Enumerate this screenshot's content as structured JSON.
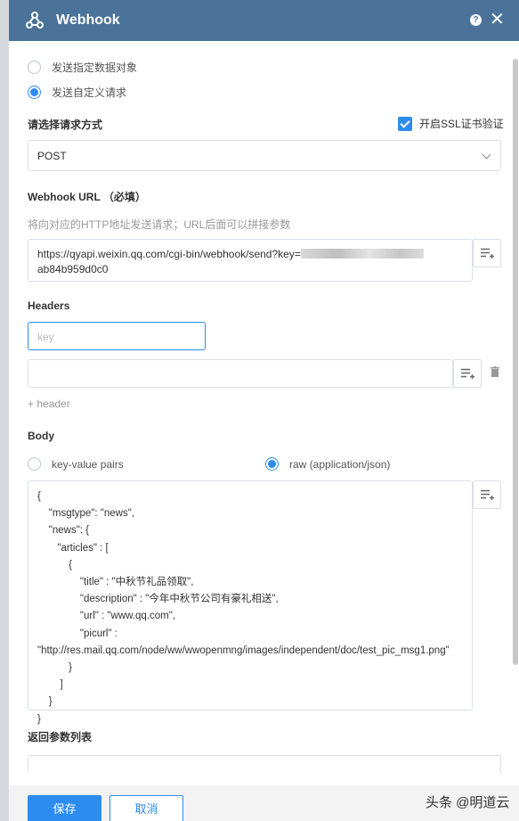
{
  "dialog": {
    "title": "Webhook",
    "help_icon": "?",
    "close_icon": "✕"
  },
  "send_mode": {
    "option_data_object": "发送指定数据对象",
    "option_custom_request": "发送自定义请求",
    "selected": "custom_request"
  },
  "request_method": {
    "label": "请选择请求方式",
    "value": "POST",
    "ssl_label": "开启SSL证书验证",
    "ssl_checked": true
  },
  "url_section": {
    "label": "Webhook URL （必填）",
    "hint": "将向对应的HTTP地址发送请求；URL后面可以拼接参数",
    "value_line1": "https://qyapi.weixin.qq.com/cgi-bin/webhook/send?key=",
    "value_line2": "ab84b959d0c0"
  },
  "headers_section": {
    "label": "Headers",
    "key_placeholder": "key",
    "add_header": "+ header"
  },
  "body_section": {
    "label": "Body",
    "option_kv": "key-value pairs",
    "option_raw": "raw (application/json)",
    "selected": "raw",
    "raw_json": "{\n    \"msgtype\": \"news\",\n    \"news\": {\n       \"articles\" : [\n           {\n               \"title\" : \"中秋节礼品领取\",\n               \"description\" : \"今年中秋节公司有豪礼相送\",\n               \"url\" : \"www.qq.com\",\n               \"picurl\" :\n\"http://res.mail.qq.com/node/ww/wwopenmng/images/independent/doc/test_pic_msg1.png\"\n           }\n        ]\n    }\n}"
  },
  "return_params": {
    "label": "返回参数列表"
  },
  "footer": {
    "save_label": "保存",
    "cancel_label": "取消"
  },
  "watermark": "头条 @明道云",
  "colors": {
    "header_bg": "#4b7399",
    "accent": "#2d8cf0"
  },
  "icons": {
    "logo": "webhook-icon",
    "insert_field": "insert-field-icon",
    "delete": "trash-icon"
  }
}
